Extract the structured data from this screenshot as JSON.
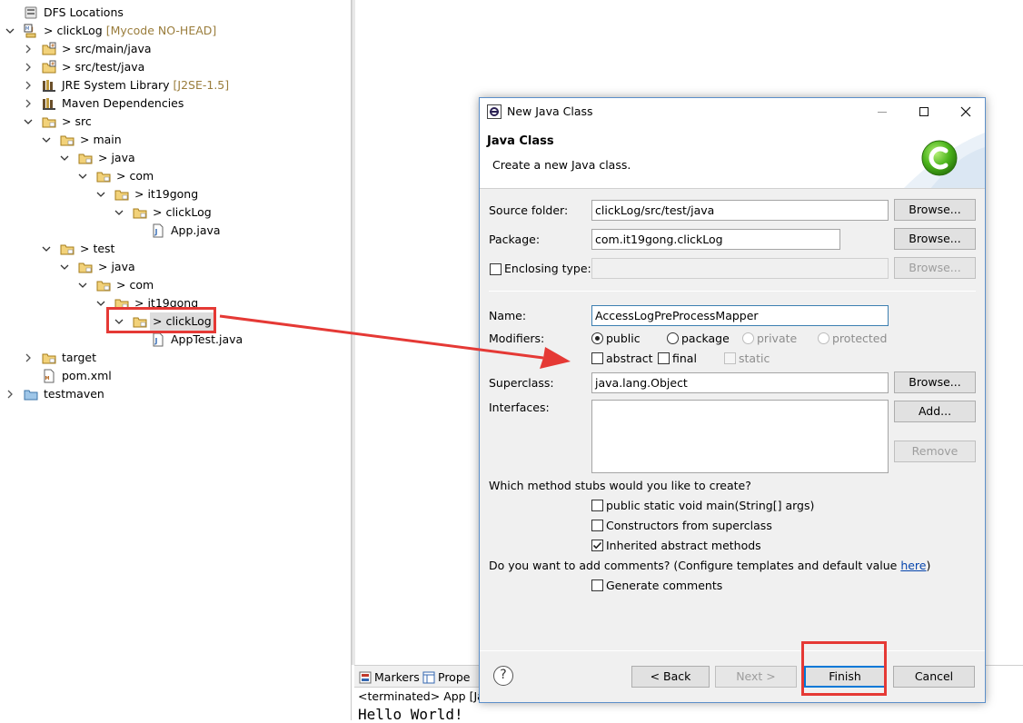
{
  "tree": {
    "rows": [
      {
        "depth": 0,
        "toggle": "none",
        "icon": "dfs",
        "label": "DFS Locations",
        "decor": ""
      },
      {
        "depth": 0,
        "toggle": "open",
        "icon": "project",
        "label": "> clickLog",
        "decor": "[Mycode NO-HEAD]"
      },
      {
        "depth": 1,
        "toggle": "closed",
        "icon": "srcfolder",
        "label": "> src/main/java",
        "decor": ""
      },
      {
        "depth": 1,
        "toggle": "closed",
        "icon": "srcfolder",
        "label": "> src/test/java",
        "decor": ""
      },
      {
        "depth": 1,
        "toggle": "closed",
        "icon": "library",
        "label": "JRE System Library",
        "decor": "[J2SE-1.5]"
      },
      {
        "depth": 1,
        "toggle": "closed",
        "icon": "library",
        "label": "Maven Dependencies",
        "decor": ""
      },
      {
        "depth": 1,
        "toggle": "open",
        "icon": "folder",
        "label": "> src",
        "decor": ""
      },
      {
        "depth": 2,
        "toggle": "open",
        "icon": "folder",
        "label": "> main",
        "decor": ""
      },
      {
        "depth": 3,
        "toggle": "open",
        "icon": "folder",
        "label": "> java",
        "decor": ""
      },
      {
        "depth": 4,
        "toggle": "open",
        "icon": "folder",
        "label": "> com",
        "decor": ""
      },
      {
        "depth": 5,
        "toggle": "open",
        "icon": "folder",
        "label": "> it19gong",
        "decor": ""
      },
      {
        "depth": 6,
        "toggle": "open",
        "icon": "folder",
        "label": "> clickLog",
        "decor": ""
      },
      {
        "depth": 7,
        "toggle": "none",
        "icon": "java",
        "label": "App.java",
        "decor": ""
      },
      {
        "depth": 2,
        "toggle": "open",
        "icon": "folder",
        "label": "> test",
        "decor": ""
      },
      {
        "depth": 3,
        "toggle": "open",
        "icon": "folder",
        "label": "> java",
        "decor": ""
      },
      {
        "depth": 4,
        "toggle": "open",
        "icon": "folder",
        "label": "> com",
        "decor": ""
      },
      {
        "depth": 5,
        "toggle": "open",
        "icon": "folder",
        "label": "> it19gong",
        "decor": ""
      },
      {
        "depth": 6,
        "toggle": "open",
        "icon": "folder",
        "label": "> clickLog",
        "decor": "",
        "selected": true
      },
      {
        "depth": 7,
        "toggle": "none",
        "icon": "java",
        "label": "AppTest.java",
        "decor": ""
      },
      {
        "depth": 1,
        "toggle": "closed",
        "icon": "folder",
        "label": "target",
        "decor": ""
      },
      {
        "depth": 1,
        "toggle": "none",
        "icon": "xml",
        "label": "pom.xml",
        "decor": ""
      },
      {
        "depth": 0,
        "toggle": "closed",
        "icon": "project2",
        "label": "testmaven",
        "decor": ""
      }
    ]
  },
  "bottom_panel": {
    "tabs": [
      {
        "label": "Markers"
      },
      {
        "label": "Prope"
      }
    ],
    "console_status": "<terminated> App [Jav",
    "console_output": "Hello World!"
  },
  "dialog": {
    "window_title": "New Java Class",
    "header_title": "Java Class",
    "header_description": "Create a new Java class.",
    "source_folder": {
      "label": "Source folder:",
      "value": "clickLog/src/test/java"
    },
    "package": {
      "label": "Package:",
      "value": "com.it19gong.clickLog"
    },
    "enclosing_type": {
      "label": "Enclosing type:",
      "value": ""
    },
    "name": {
      "label": "Name:",
      "value": "AccessLogPreProcessMapper"
    },
    "modifiers": {
      "label": "Modifiers:",
      "access": [
        {
          "label": "public",
          "selected": true,
          "enabled": true
        },
        {
          "label": "package",
          "selected": false,
          "enabled": true
        },
        {
          "label": "private",
          "selected": false,
          "enabled": false
        },
        {
          "label": "protected",
          "selected": false,
          "enabled": false
        }
      ],
      "flags": [
        {
          "label": "abstract",
          "checked": false,
          "enabled": true
        },
        {
          "label": "final",
          "checked": false,
          "enabled": true
        },
        {
          "label": "static",
          "checked": false,
          "enabled": false
        }
      ]
    },
    "superclass": {
      "label": "Superclass:",
      "value": "java.lang.Object"
    },
    "interfaces": {
      "label": "Interfaces:"
    },
    "browse_label": "Browse...",
    "add_label": "Add...",
    "remove_label": "Remove",
    "stubs": {
      "question": "Which method stubs would you like to create?",
      "options": [
        {
          "label": "public static void main(String[] args)",
          "checked": false
        },
        {
          "label": "Constructors from superclass",
          "checked": false
        },
        {
          "label": "Inherited abstract methods",
          "checked": true
        }
      ]
    },
    "comments": {
      "question_prefix": "Do you want to add comments? (Configure templates and default value ",
      "link": "here",
      "question_suffix": ")",
      "option": {
        "label": "Generate comments",
        "checked": false
      }
    },
    "buttons": {
      "help": "?",
      "back": "< Back",
      "next": "Next >",
      "finish": "Finish",
      "cancel": "Cancel"
    }
  },
  "colors": {
    "annotation": "#e53935",
    "accent": "#0078d7",
    "decoration": "#9a7d3c"
  }
}
